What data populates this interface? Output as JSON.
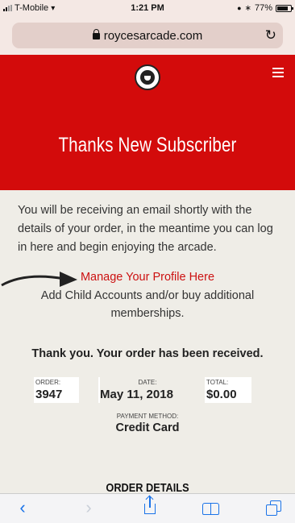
{
  "status_bar": {
    "carrier": "T-Mobile",
    "time": "1:21 PM",
    "battery": "77%"
  },
  "browser": {
    "url": "roycesarcade.com"
  },
  "hero": {
    "title": "Thanks New Subscriber",
    "background_color": "#d30b0b"
  },
  "content": {
    "intro": "You will be receiving an email shortly with the details of your order, in the meantime you can log in here and begin enjoying the arcade.",
    "manage_link": "Manage Your Profile Here",
    "add_child": "Add Child Accounts and/or buy additional memberships.",
    "thanks": "Thank you. Your order has been received."
  },
  "order": {
    "order_label": "ORDER:",
    "order_value": "3947",
    "date_label": "DATE:",
    "date_value": "May 11, 2018",
    "total_label": "TOTAL:",
    "total_value": "$0.00",
    "payment_label": "PAYMENT METHOD:",
    "payment_value": "Credit Card",
    "details_heading": "ORDER DETAILS"
  },
  "toolbar": {
    "back": "‹",
    "forward": "›"
  },
  "colors": {
    "accent": "#1a73e8",
    "link": "#cc1111"
  }
}
